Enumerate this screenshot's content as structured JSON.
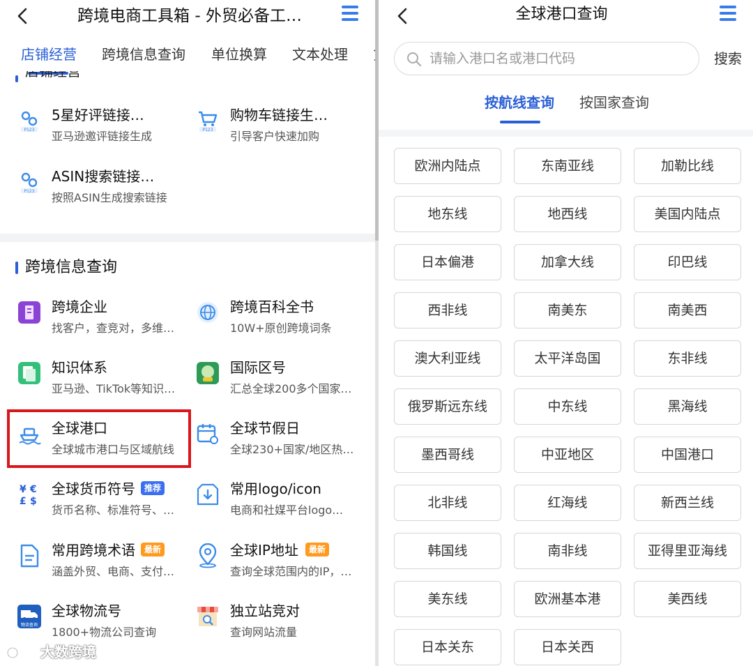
{
  "left": {
    "title": "跨境电商工具箱 - 外贸必备工…",
    "tabs": [
      "店铺经营",
      "跨境信息查询",
      "单位换算",
      "文本处理",
      "货"
    ],
    "cut_section_text": "店铺经营",
    "store_items": [
      {
        "name": "5星好评链接…",
        "desc": "亚马逊邀评链接生成",
        "icon": "link-icon"
      },
      {
        "name": "购物车链接生…",
        "desc": "引导客户快速加购",
        "icon": "cart-link-icon"
      },
      {
        "name": "ASIN搜索链接…",
        "desc": "按照ASIN生成搜索链接",
        "icon": "link-icon"
      }
    ],
    "icon_caption": "P123",
    "section_title": "跨境信息查询",
    "info_items": [
      {
        "name": "跨境企业",
        "desc": "找客户，查竞对，多维…",
        "icon": "enterprise-icon"
      },
      {
        "name": "跨境百科全书",
        "desc": "10W+原创跨境词条",
        "icon": "encyclopedia-icon"
      },
      {
        "name": "知识体系",
        "desc": "亚马逊、TikTok等知识…",
        "icon": "knowledge-icon"
      },
      {
        "name": "国际区号",
        "desc": "汇总全球200多个国家…",
        "icon": "phone-code-icon"
      },
      {
        "name": "全球港口",
        "desc": "全球城市港口与区域航线",
        "icon": "ship-icon"
      },
      {
        "name": "全球节假日",
        "desc": "全球230+国家/地区热…",
        "icon": "calendar-icon"
      },
      {
        "name": "全球货币符号",
        "desc": "货币名称、标准符号、…",
        "icon": "currency-icon",
        "badge": "推荐"
      },
      {
        "name": "常用logo/icon",
        "desc": "电商和社媒平台logo…",
        "icon": "download-icon"
      },
      {
        "name": "常用跨境术语",
        "desc": "涵盖外贸、电商、支付…",
        "icon": "document-icon",
        "badge": "最新"
      },
      {
        "name": "全球IP地址",
        "desc": "查询全球范围内的IP，…",
        "icon": "location-icon",
        "badge": "最新"
      },
      {
        "name": "全球物流号",
        "desc": "1800+物流公司查询",
        "icon": "truck-icon"
      },
      {
        "name": "独立站竞对",
        "desc": "查询网站流量",
        "icon": "store-search-icon"
      }
    ],
    "truck_icon_caption": "物流查询",
    "watermark": "大数跨境"
  },
  "right": {
    "title": "全球港口查询",
    "search_placeholder": "请输入港口名或港口代码",
    "search_button": "搜索",
    "tabs": [
      "按航线查询",
      "按国家查询"
    ],
    "active_tab": "按航线查询",
    "routes": [
      "欧洲内陆点",
      "东南亚线",
      "加勒比线",
      "地东线",
      "地西线",
      "美国内陆点",
      "日本偏港",
      "加拿大线",
      "印巴线",
      "西非线",
      "南美东",
      "南美西",
      "澳大利亚线",
      "太平洋岛国",
      "东非线",
      "俄罗斯远东线",
      "中东线",
      "黑海线",
      "墨西哥线",
      "中亚地区",
      "中国港口",
      "北非线",
      "红海线",
      "新西兰线",
      "韩国线",
      "南非线",
      "亚得里亚海线",
      "美东线",
      "欧洲基本港",
      "美西线",
      "日本关东",
      "日本关西"
    ]
  },
  "colors": {
    "accent": "#2a5fd6",
    "highlight_box": "#d9161c",
    "badge_recommend": "#3b6ff0",
    "badge_new": "#ff9a1f"
  }
}
